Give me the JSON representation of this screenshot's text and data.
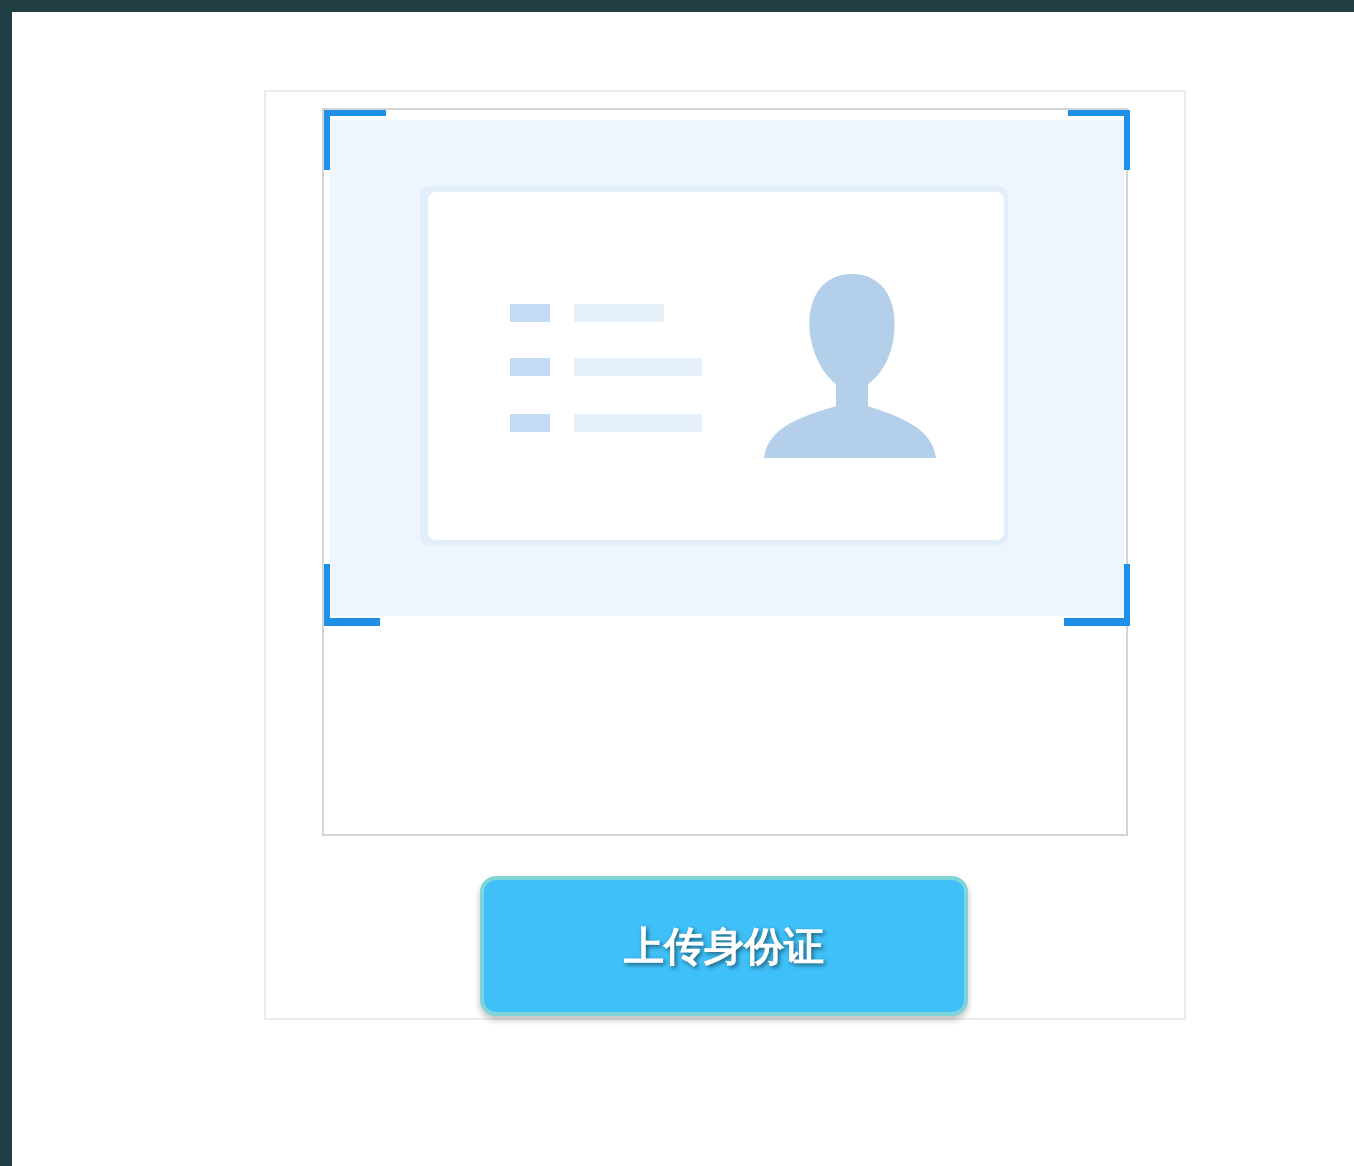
{
  "upload_button": {
    "label": "上传身份证"
  }
}
